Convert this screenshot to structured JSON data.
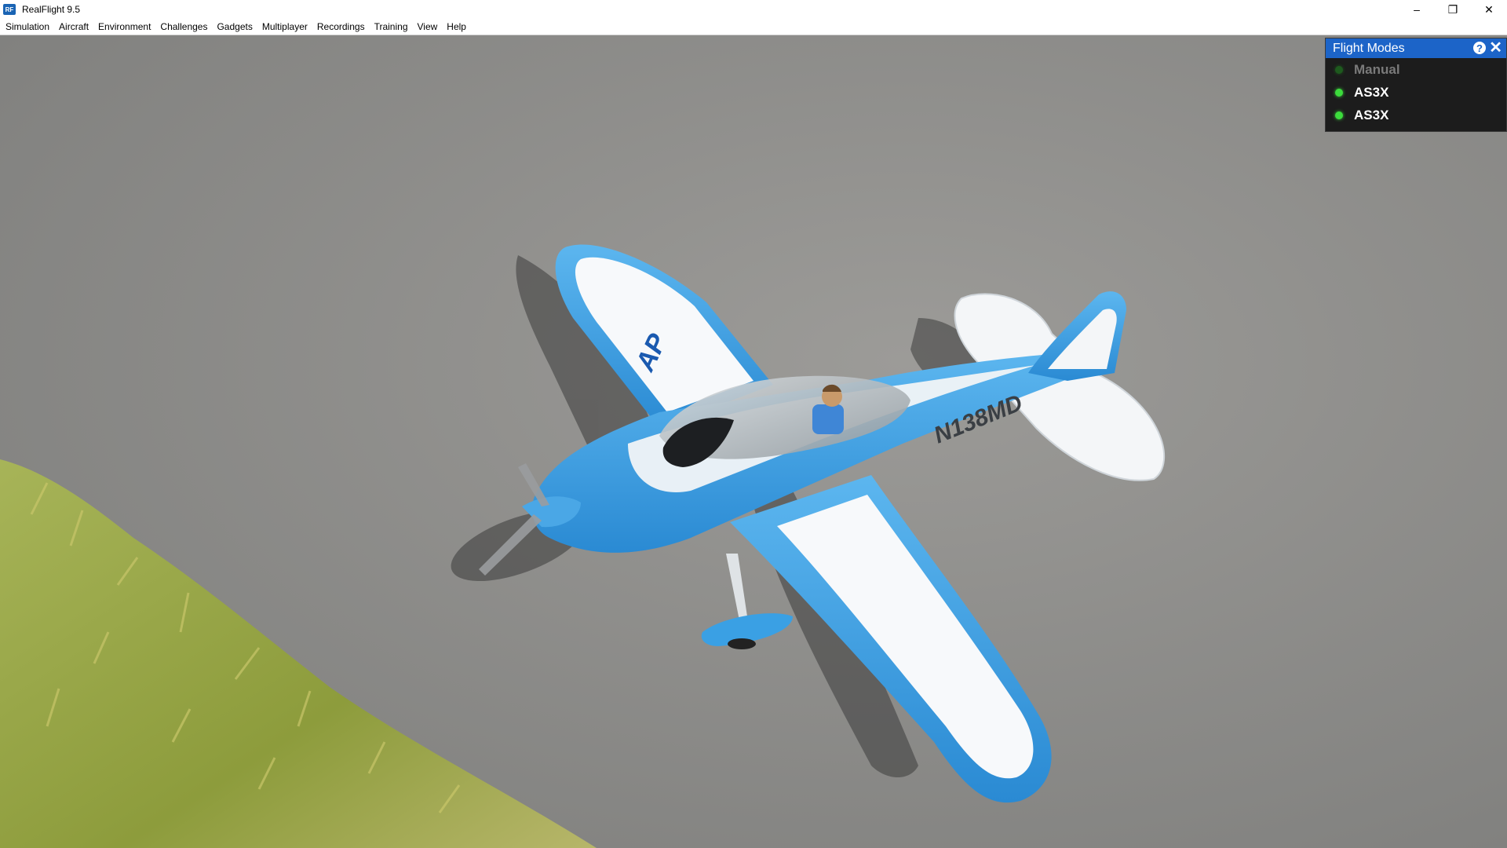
{
  "window": {
    "title": "RealFlight 9.5",
    "icon_text": "RF",
    "controls": {
      "minimize": "–",
      "restore": "❐",
      "close": "✕"
    }
  },
  "menu": {
    "items": [
      {
        "label": "Simulation"
      },
      {
        "label": "Aircraft"
      },
      {
        "label": "Environment"
      },
      {
        "label": "Challenges"
      },
      {
        "label": "Gadgets"
      },
      {
        "label": "Multiplayer"
      },
      {
        "label": "Recordings"
      },
      {
        "label": "Training"
      },
      {
        "label": "View"
      },
      {
        "label": "Help"
      }
    ]
  },
  "scene": {
    "aircraft_registration": "N138MD",
    "wing_marking": "AP",
    "colors": {
      "fuselage_blue": "#3a9fe0",
      "wing_white": "#f7f9fb",
      "tarmac": "#8f8f8d",
      "grass": "#9aaa4a"
    }
  },
  "flight_modes": {
    "title": "Flight Modes",
    "help": "?",
    "close": "✕",
    "modes": [
      {
        "label": "Manual",
        "active": false,
        "led_color": "#1e5a1e",
        "text_color": "#7a7a7a"
      },
      {
        "label": "AS3X",
        "active": true,
        "led_color": "#3cdc3c",
        "text_color": "#ffffff"
      },
      {
        "label": "AS3X",
        "active": true,
        "led_color": "#3cdc3c",
        "text_color": "#ffffff"
      }
    ]
  }
}
